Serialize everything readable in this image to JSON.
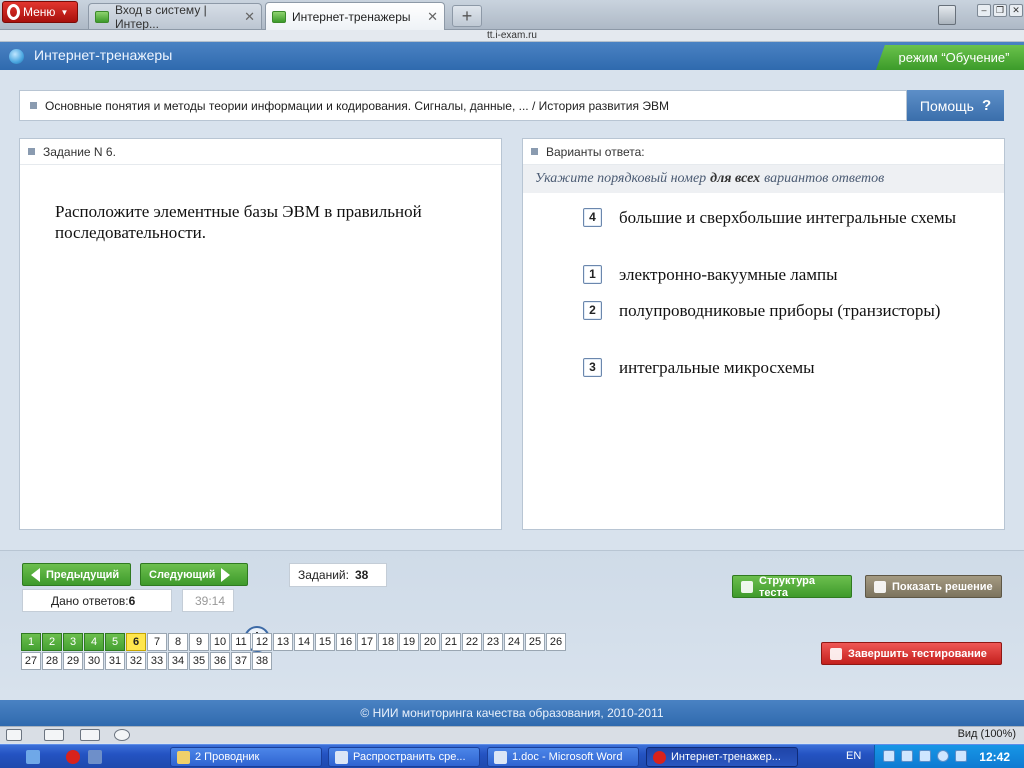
{
  "browser": {
    "menu_label": "Меню",
    "tabs": [
      {
        "label": "Вход в систему | Интер...",
        "close": "✕"
      },
      {
        "label": "Интернет-тренажеры",
        "close": "✕"
      }
    ],
    "new_tab_label": "+",
    "address": "tt.i-exam.ru"
  },
  "header": {
    "title": "Интернет-тренажеры",
    "mode": "режим “Обучение”"
  },
  "breadcrumb": {
    "text": "Основные понятия и методы теории информации и кодирования. Сигналы, данные, ... / История развития ЭВМ",
    "help_label": "Помощь",
    "help_icon": "?"
  },
  "question": {
    "heading": "Задание N 6.",
    "text": "Расположите элементные базы ЭВМ в правильной последовательности."
  },
  "answers": {
    "heading": "Варианты ответа:",
    "instruction_pre": "Укажите порядковый номер",
    "instruction_bold": "для всех",
    "instruction_post": "вариантов ответов",
    "options": [
      {
        "number": "4",
        "text": "большие и сверхбольшие интегральные схемы"
      },
      {
        "number": "1",
        "text": "электронно-вакуумные лампы"
      },
      {
        "number": "2",
        "text": "полупроводниковые приборы (транзисторы)"
      },
      {
        "number": "3",
        "text": "интегральные микросхемы"
      }
    ]
  },
  "controls": {
    "prev_label": "Предыдущий",
    "next_label": "Следующий",
    "tasks_label": "Заданий:",
    "tasks_count": "38",
    "answered_label": "Дано ответов:",
    "answered_count": "6",
    "timer": "39:14",
    "structure_label": "Структура теста",
    "solution_label": "Показать решение",
    "finish_label": "Завершить тестирование"
  },
  "question_grid": {
    "row1": [
      "1",
      "2",
      "3",
      "4",
      "5",
      "6",
      "7",
      "8",
      "9",
      "10",
      "11",
      "12",
      "13",
      "14",
      "15",
      "16",
      "17",
      "18",
      "19",
      "20",
      "21",
      "22",
      "23",
      "24",
      "25",
      "26"
    ],
    "row2": [
      "27",
      "28",
      "29",
      "30",
      "31",
      "32",
      "33",
      "34",
      "35",
      "36",
      "37",
      "38"
    ],
    "answered": [
      "1",
      "2",
      "3",
      "4",
      "5"
    ],
    "current": "6"
  },
  "footer": {
    "copyright": "© НИИ мониторинга качества образования, 2010-2011"
  },
  "statusbar": {
    "zoom": "Вид (100%)"
  },
  "taskbar": {
    "items": [
      {
        "label": "2 Проводник"
      },
      {
        "label": "Распространить сре..."
      },
      {
        "label": "1.doc - Microsoft Word"
      },
      {
        "label": "Интернет-тренажер..."
      }
    ],
    "language": "EN",
    "time": "12:42"
  },
  "colors": {
    "header_blue": "#2f6aae",
    "answered_green": "#45a132",
    "current_yellow": "#ffe64d",
    "finish_red": "#c4201d"
  }
}
